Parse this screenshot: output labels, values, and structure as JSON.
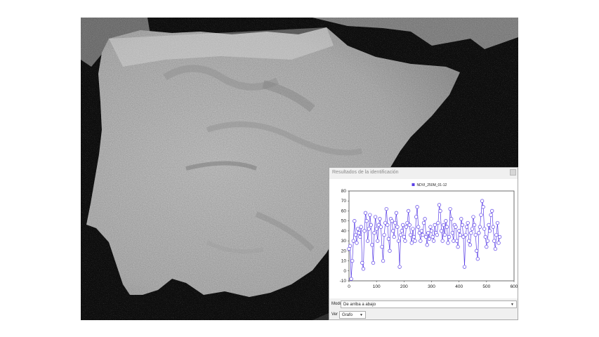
{
  "panel": {
    "title": "Resultados de la identificación",
    "mode_label": "Modo",
    "mode_value": "De arriba a abajo",
    "view_label": "Ver",
    "view_value": "Grafo"
  },
  "icons": {
    "close": "close-icon",
    "dropdown": "chevron-down-icon"
  },
  "colors": {
    "series": "#5a3fe6",
    "map_bg": "#0d0d0d",
    "land": "#bdbdbd"
  },
  "chart_data": {
    "type": "line",
    "legend": "NDVI_250M_01-12",
    "legend_placement": "top",
    "grid": false,
    "xlim": [
      0,
      600
    ],
    "ylim": [
      -10,
      80
    ],
    "xticks": [
      0,
      100,
      200,
      300,
      400,
      500,
      600
    ],
    "yticks": [
      -10,
      0,
      10,
      20,
      30,
      40,
      50,
      60,
      70,
      80
    ],
    "series": [
      {
        "name": "NDVI_250M_01-12",
        "x": [
          0,
          4,
          8,
          12,
          16,
          20,
          24,
          28,
          32,
          36,
          40,
          44,
          48,
          52,
          56,
          60,
          64,
          68,
          72,
          76,
          80,
          84,
          88,
          92,
          96,
          100,
          104,
          108,
          112,
          116,
          120,
          124,
          128,
          132,
          136,
          140,
          144,
          148,
          152,
          156,
          160,
          164,
          168,
          172,
          176,
          180,
          184,
          188,
          192,
          196,
          200,
          204,
          208,
          212,
          216,
          220,
          224,
          228,
          232,
          236,
          240,
          244,
          248,
          252,
          256,
          260,
          264,
          268,
          272,
          276,
          280,
          284,
          288,
          292,
          296,
          300,
          304,
          308,
          312,
          316,
          320,
          324,
          328,
          332,
          336,
          340,
          344,
          348,
          352,
          356,
          360,
          364,
          368,
          372,
          376,
          380,
          384,
          388,
          392,
          396,
          400,
          404,
          408,
          412,
          416,
          420,
          424,
          428,
          432,
          436,
          440,
          444,
          448,
          452,
          456,
          460,
          464,
          468,
          472,
          476,
          480,
          484,
          488,
          492,
          496,
          500,
          504,
          508,
          512,
          516,
          520,
          524,
          528,
          532,
          536,
          540,
          544,
          548
        ],
        "y": [
          22,
          25,
          -8,
          10,
          30,
          50,
          36,
          28,
          42,
          38,
          34,
          44,
          8,
          2,
          40,
          58,
          50,
          30,
          42,
          56,
          46,
          26,
          8,
          38,
          54,
          42,
          30,
          46,
          52,
          44,
          24,
          10,
          36,
          48,
          62,
          46,
          32,
          20,
          52,
          50,
          40,
          34,
          48,
          58,
          44,
          30,
          4,
          36,
          40,
          46,
          34,
          30,
          44,
          48,
          60,
          46,
          36,
          28,
          42,
          34,
          30,
          54,
          64,
          44,
          38,
          30,
          40,
          36,
          48,
          52,
          34,
          26,
          38,
          32,
          44,
          40,
          34,
          30,
          46,
          38,
          36,
          48,
          66,
          60,
          40,
          30,
          46,
          36,
          50,
          44,
          28,
          34,
          62,
          52,
          38,
          30,
          46,
          44,
          30,
          24,
          40,
          36,
          52,
          46,
          34,
          4,
          36,
          44,
          48,
          30,
          26,
          38,
          42,
          54,
          46,
          36,
          20,
          12,
          38,
          44,
          56,
          70,
          64,
          42,
          34,
          24,
          30,
          46,
          40,
          56,
          60,
          44,
          30,
          22,
          36,
          48,
          28,
          34
        ]
      }
    ]
  }
}
